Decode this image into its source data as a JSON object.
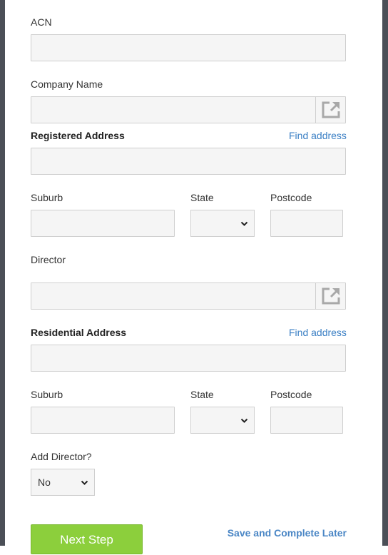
{
  "form": {
    "acn": {
      "label": "ACN",
      "value": ""
    },
    "company_name": {
      "label": "Company Name",
      "value": "",
      "button_icon": "external-link-icon"
    },
    "registered_address": {
      "label": "Registered Address",
      "find_label": "Find address",
      "value": ""
    },
    "registered_suburb": {
      "label": "Suburb",
      "value": ""
    },
    "registered_state": {
      "label": "State",
      "value": ""
    },
    "registered_postcode": {
      "label": "Postcode",
      "value": ""
    },
    "director": {
      "label": "Director",
      "value": "",
      "button_icon": "external-link-icon"
    },
    "residential_address": {
      "label": "Residential Address",
      "find_label": "Find address",
      "value": ""
    },
    "residential_suburb": {
      "label": "Suburb",
      "value": ""
    },
    "residential_state": {
      "label": "State",
      "value": ""
    },
    "residential_postcode": {
      "label": "Postcode",
      "value": ""
    },
    "add_director": {
      "label": "Add Director?",
      "value": "No"
    }
  },
  "actions": {
    "next_label": "Next Step",
    "save_label": "Save and Complete Later"
  },
  "colors": {
    "accent": "#8ccf3c",
    "link": "#3a7fc4",
    "field_bg": "#f5f5f5",
    "side_rail": "#4b4f57"
  }
}
